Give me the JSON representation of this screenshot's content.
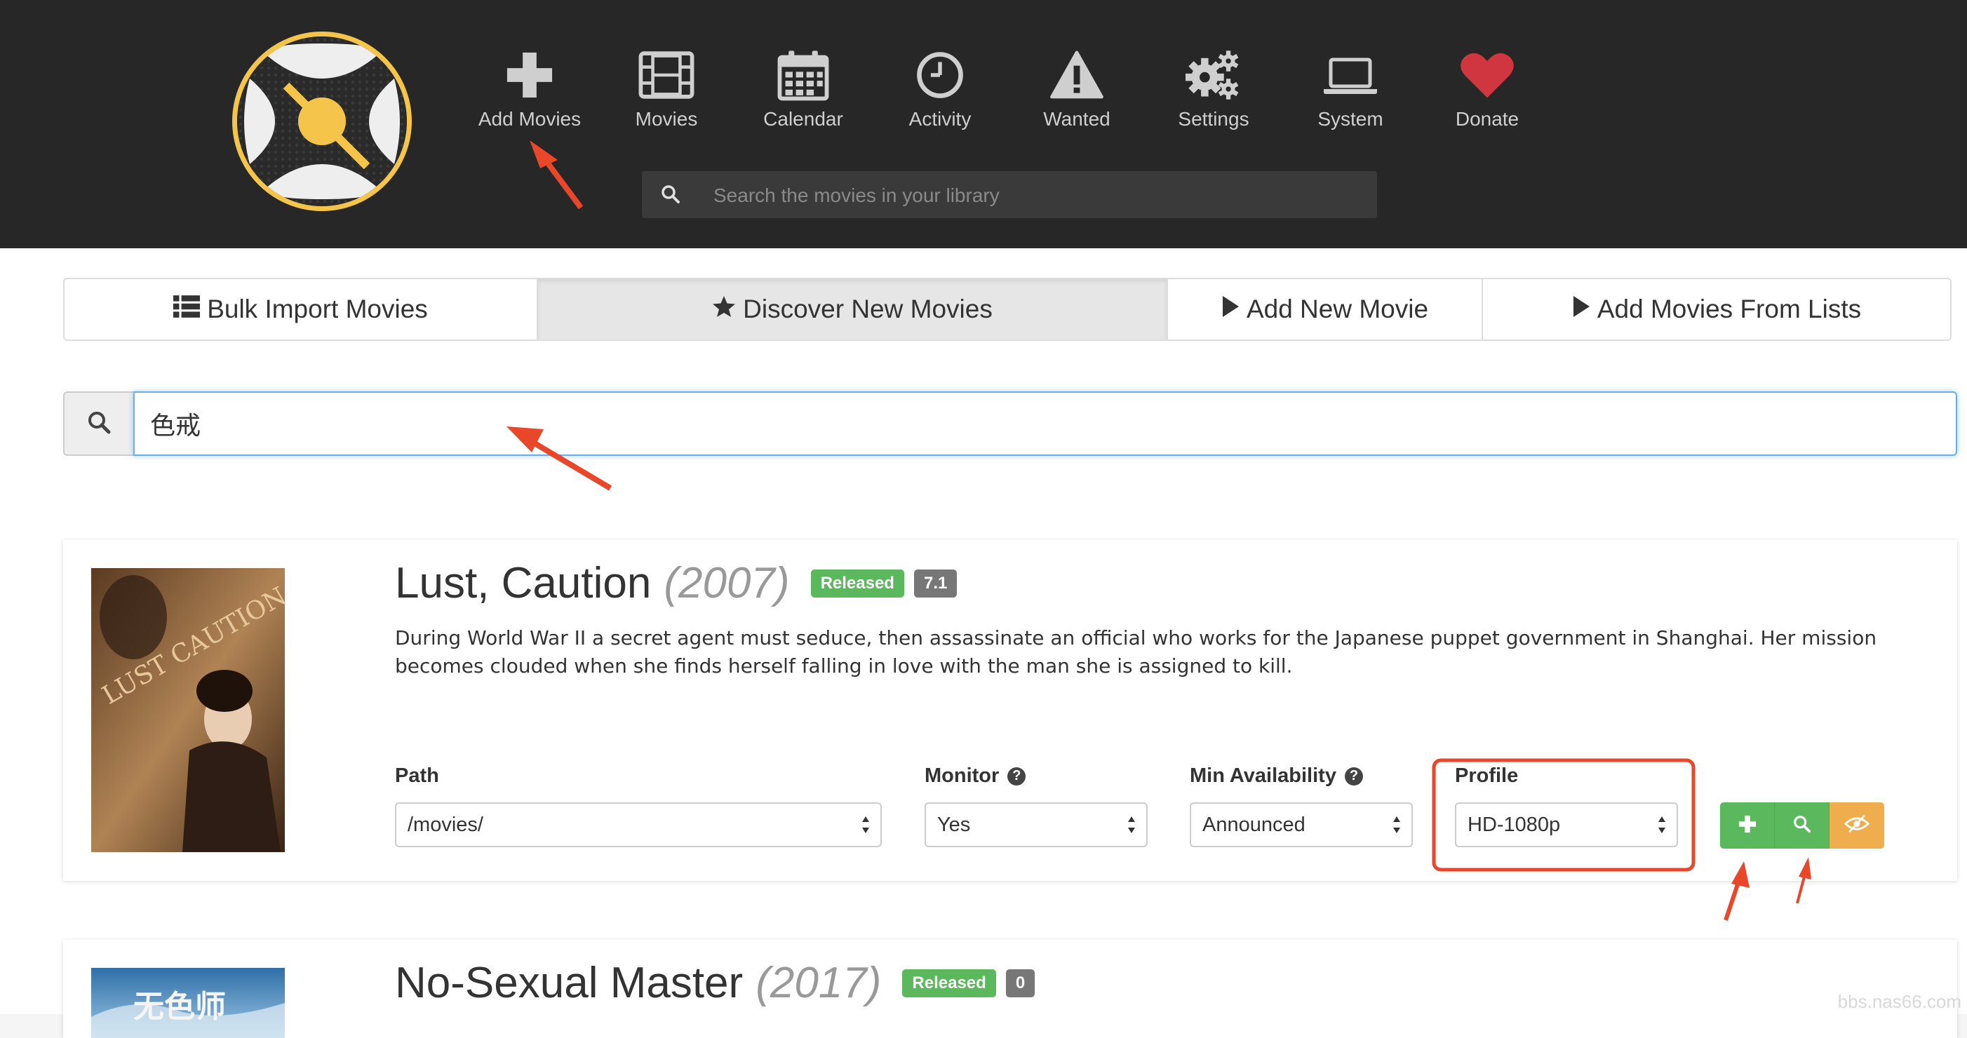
{
  "nav": {
    "items": [
      {
        "label": "Add Movies",
        "icon": "plus-icon"
      },
      {
        "label": "Movies",
        "icon": "film-icon"
      },
      {
        "label": "Calendar",
        "icon": "calendar-icon"
      },
      {
        "label": "Activity",
        "icon": "clock-icon"
      },
      {
        "label": "Wanted",
        "icon": "warning-icon"
      },
      {
        "label": "Settings",
        "icon": "gears-icon"
      },
      {
        "label": "System",
        "icon": "laptop-icon"
      },
      {
        "label": "Donate",
        "icon": "heart-icon"
      }
    ],
    "search_placeholder": "Search the movies in your library"
  },
  "tabs": [
    {
      "label": "Bulk Import Movies",
      "icon": "list-icon"
    },
    {
      "label": "Discover New Movies",
      "icon": "star-icon",
      "active": true
    },
    {
      "label": "Add New Movie",
      "icon": "play-icon"
    },
    {
      "label": "Add Movies From Lists",
      "icon": "play-icon"
    }
  ],
  "search": {
    "value": "色戒"
  },
  "movies": [
    {
      "title": "Lust, Caution",
      "year": "(2007)",
      "status": "Released",
      "rating": "7.1",
      "overview": "During World War II a secret agent must seduce, then assassinate an official who works for the Japanese puppet government in Shanghai. Her mission becomes clouded when she finds herself falling in love with the man she is assigned to kill.",
      "path_label": "Path",
      "path_value": "/movies/",
      "monitor_label": "Monitor",
      "monitor_value": "Yes",
      "availability_label": "Min Availability",
      "availability_value": "Announced",
      "profile_label": "Profile",
      "profile_value": "HD-1080p",
      "poster_text": "LUST CAUTION"
    },
    {
      "title": "No-Sexual Master",
      "year": "(2017)",
      "status": "Released",
      "rating": "0",
      "poster_text": "无色师"
    }
  ],
  "colors": {
    "header_bg": "#272727",
    "accent_blue": "#66afe9",
    "success_green": "#5cb85c",
    "warning_orange": "#f0ad4e",
    "annotation_red": "#e8472a",
    "heart_red": "#d0363f",
    "logo_gold": "#f5c44a"
  },
  "watermark": "bbs.nas66.com"
}
